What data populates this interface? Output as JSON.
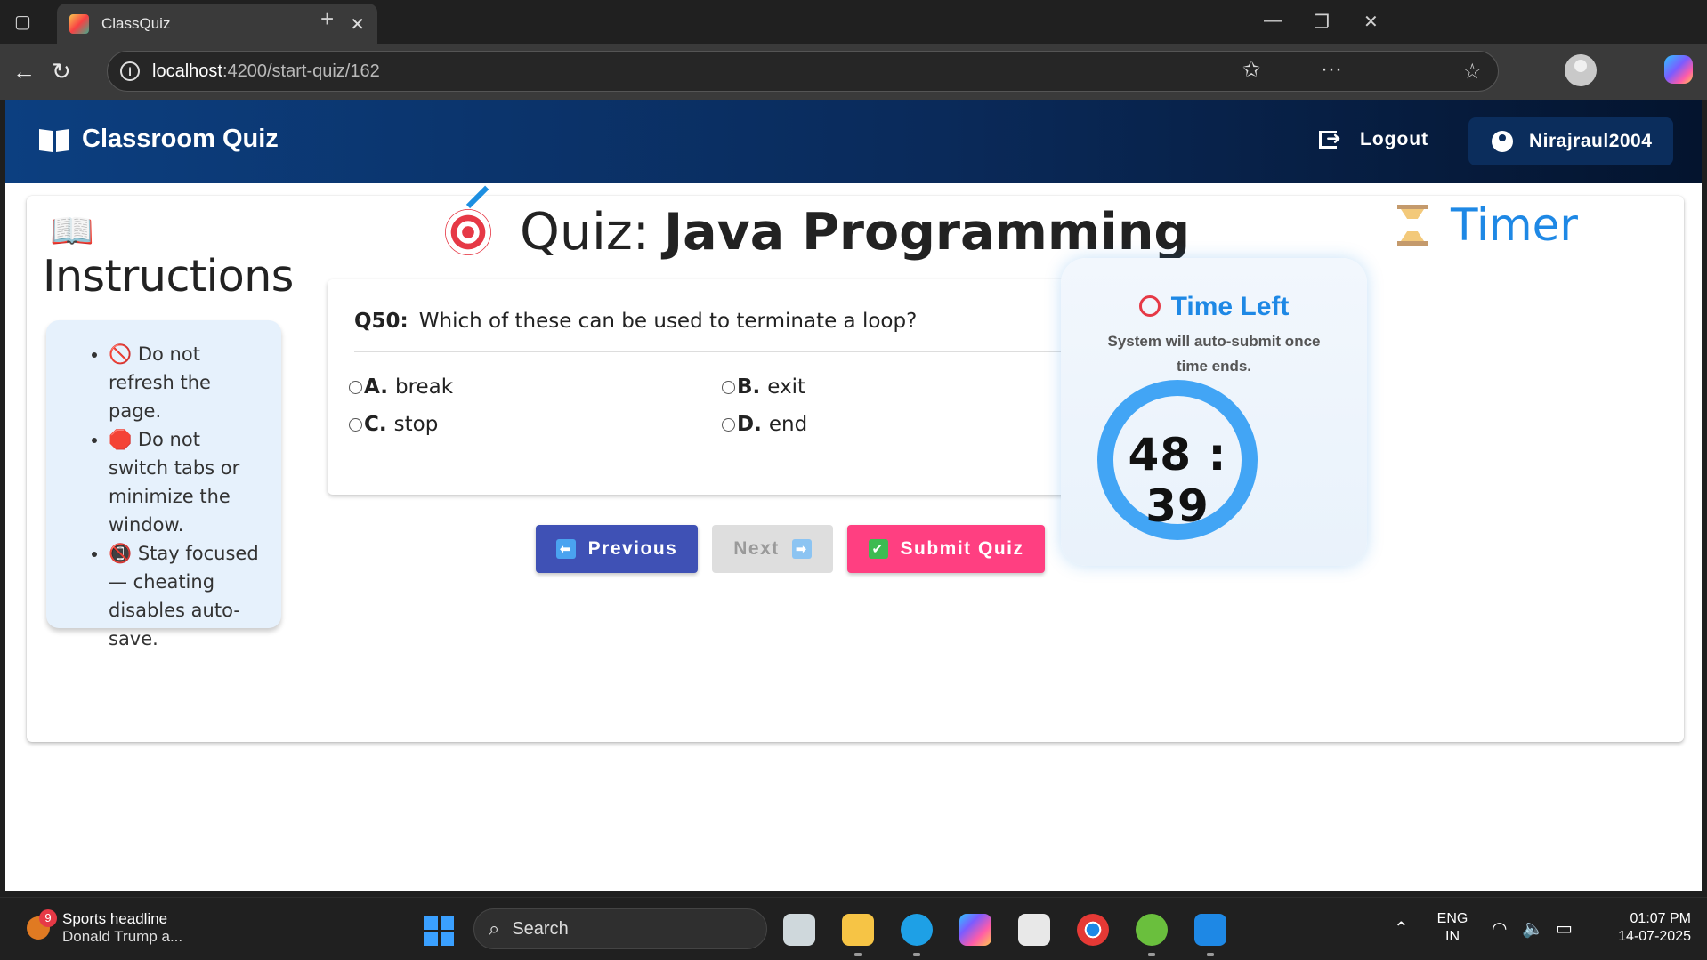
{
  "browser": {
    "tab_title": "ClassQuiz",
    "url_host": "localhost",
    "url_path": ":4200/start-quiz/162"
  },
  "header": {
    "brand": "Classroom Quiz",
    "logout_label": "Logout",
    "username": "Nirajraul2004"
  },
  "instructions": {
    "title": "Instructions",
    "items": [
      "Do not refresh the page.",
      "Do not switch tabs or minimize the window.",
      "Stay focused — cheating disables auto-save."
    ]
  },
  "quiz": {
    "title_prefix": "Quiz:",
    "title_name": "Java Programming",
    "question_number": "Q50:",
    "question_text": "Which of these can be used to terminate a loop?",
    "options": [
      {
        "letter": "A.",
        "text": "break"
      },
      {
        "letter": "B.",
        "text": "exit"
      },
      {
        "letter": "C.",
        "text": "stop"
      },
      {
        "letter": "D.",
        "text": "end"
      }
    ],
    "buttons": {
      "previous": "Previous",
      "next": "Next",
      "submit": "Submit Quiz"
    }
  },
  "timer": {
    "heading": "Timer",
    "time_left_label": "Time Left",
    "subtitle": "System will auto-submit once time ends.",
    "value": "48 : 39"
  },
  "taskbar": {
    "news_badge": "9",
    "news_title": "Sports headline",
    "news_sub": "Donald Trump a...",
    "search_placeholder": "Search",
    "lang_top": "ENG",
    "lang_bottom": "IN",
    "time": "01:07 PM",
    "date": "14-07-2025"
  },
  "colors": {
    "accent_blue": "#1e88e5",
    "prev_button": "#3f51b5",
    "submit_button": "#ff3f81"
  }
}
